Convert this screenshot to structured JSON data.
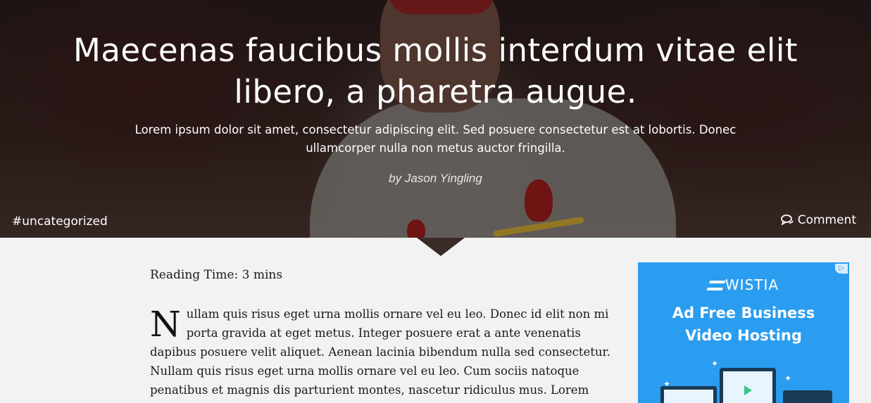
{
  "hero": {
    "title": "Maecenas faucibus mollis interdum vitae elit libero, a pharetra augue.",
    "subtitle": "Lorem ipsum dolor sit amet, consectetur adipiscing elit. Sed posuere consectetur est at lobortis. Donec ullamcorper nulla non metus auctor fringilla.",
    "author": "by Jason Yingling",
    "category_tag": "#uncategorized",
    "comment_label": "Comment",
    "comment_icon": "speech-bubbles-icon"
  },
  "article": {
    "reading_time": "Reading Time: 3 mins",
    "dropcap": "N",
    "body": "ullam quis risus eget urna mollis ornare vel eu leo. Donec id elit non mi porta gravida at eget metus. Integer posuere erat a ante venenatis dapibus posuere velit aliquet. Aenean lacinia bibendum nulla sed consectetur. Nullam quis risus eget urna mollis ornare vel eu leo. Cum sociis natoque penatibus et magnis dis parturient montes, nascetur ridiculus mus. Lorem"
  },
  "ad": {
    "brand": "WISTIA",
    "headline_line1": "Ad Free Business",
    "headline_line2": "Video Hosting",
    "badge_icon": "adchoices-icon",
    "background_color": "#2a9df0"
  }
}
